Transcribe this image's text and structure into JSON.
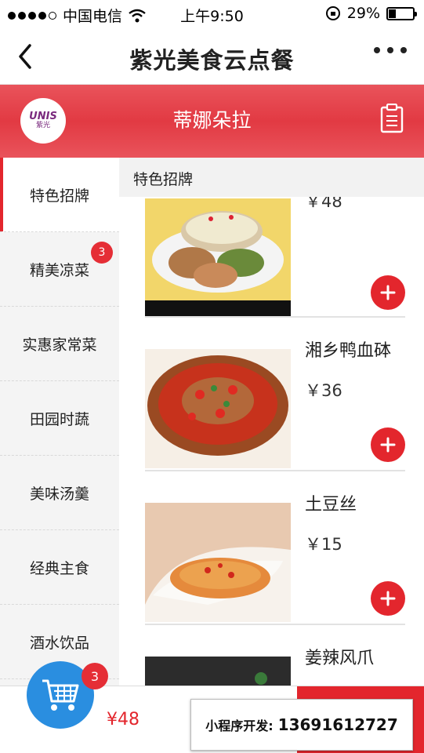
{
  "status_bar": {
    "carrier": "中国电信",
    "time": "上午9:50",
    "battery": "29%",
    "battery_level": 0.29
  },
  "nav": {
    "title": "紫光美食云点餐"
  },
  "shop": {
    "logo_text": "UNIS",
    "logo_sub": "紫光",
    "name": "蒂娜朵拉"
  },
  "categories": [
    {
      "label": "特色招牌",
      "active": true
    },
    {
      "label": "精美凉菜",
      "badge": "3"
    },
    {
      "label": "实惠家常菜"
    },
    {
      "label": "田园时蔬"
    },
    {
      "label": "美味汤羹"
    },
    {
      "label": "经典主食"
    },
    {
      "label": "酒水饮品"
    }
  ],
  "section": {
    "title": "特色招牌"
  },
  "items": [
    {
      "name": "",
      "price": "￥48"
    },
    {
      "name": "湘乡鸭血砵",
      "price": "￥36"
    },
    {
      "name": "土豆丝",
      "price": "￥15"
    },
    {
      "name": "姜辣风爪",
      "price": ""
    }
  ],
  "cart": {
    "badge": "3",
    "total": "¥48"
  },
  "promo": {
    "label": "小程序开发:",
    "phone": "13691612727"
  },
  "colors": {
    "accent": "#e3262d",
    "cart": "#2a8ee0",
    "header_red": "#e23a43"
  }
}
